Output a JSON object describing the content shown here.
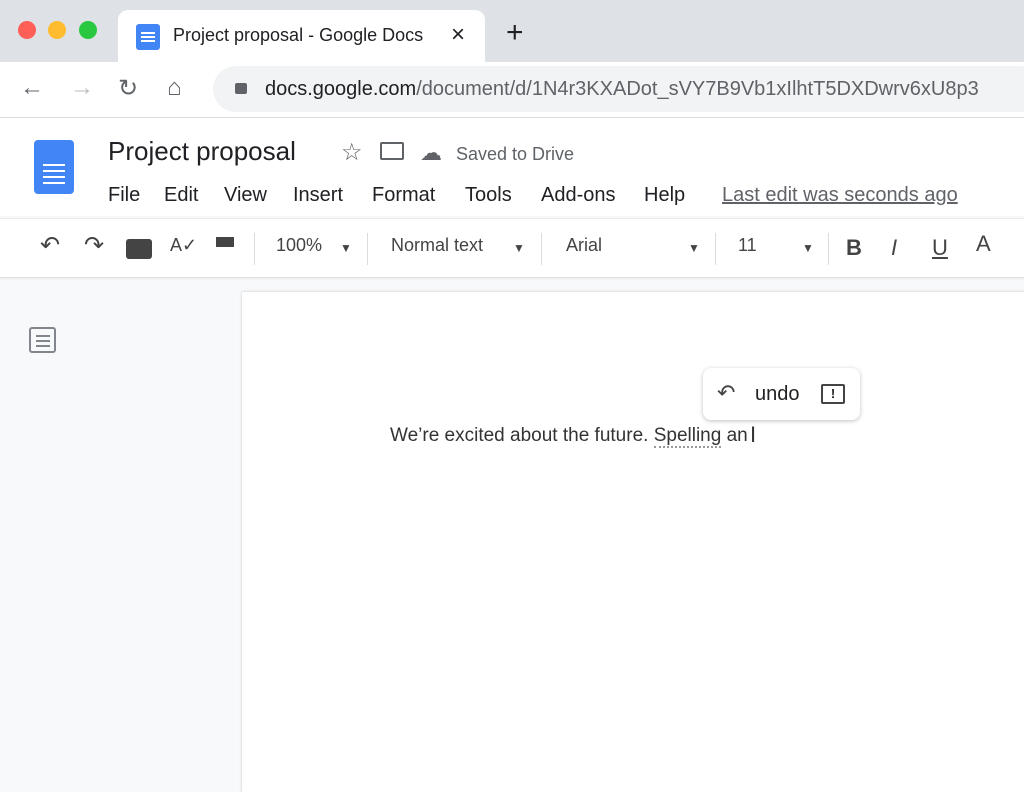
{
  "browser": {
    "tab_title": "Project proposal - Google Docs",
    "close_glyph": "×",
    "new_tab_glyph": "+",
    "url_domain": "docs.google.com",
    "url_path": "/document/d/1N4r3KXADot_sVY7B9Vb1xIlhtT5DXDwrv6xU8p3"
  },
  "doc": {
    "title": "Project proposal",
    "saved_status": "Saved to Drive",
    "last_edit": "Last edit was seconds ago",
    "menu": [
      "File",
      "Edit",
      "View",
      "Insert",
      "Format",
      "Tools",
      "Add-ons",
      "Help"
    ]
  },
  "toolbar": {
    "zoom": "100%",
    "style": "Normal text",
    "font": "Arial",
    "size": "11",
    "bold": "B",
    "italic": "I",
    "underline": "U",
    "text_color": "A"
  },
  "body": {
    "text_before": "We’re excited about the future. ",
    "text_misspelled": "Spelling",
    "text_after": " an"
  },
  "popup": {
    "label": "undo"
  },
  "colors": {
    "accent": "#4285f4",
    "tabbar": "#dee1e6"
  }
}
